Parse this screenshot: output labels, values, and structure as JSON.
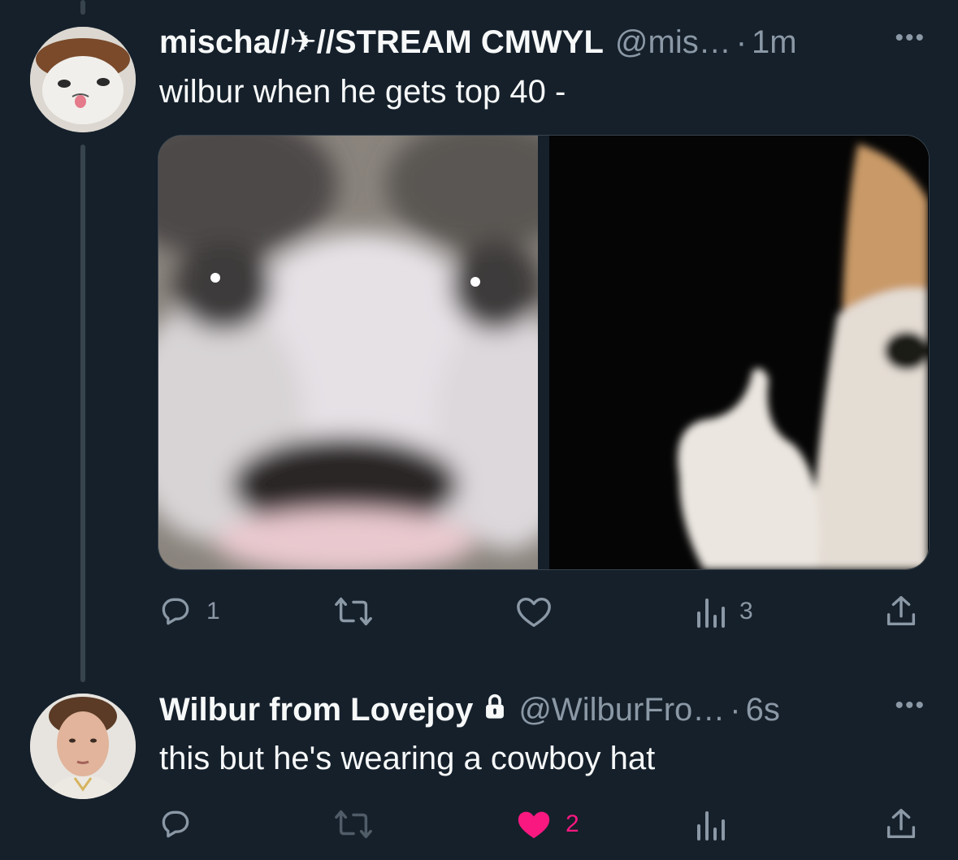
{
  "tweets": [
    {
      "display_name": "mischa//✈//STREAM CMWYL",
      "handle": "@mis…",
      "separator": "·",
      "time": "1m",
      "more": "•••",
      "text": "wilbur when he gets top 40 -",
      "actions": {
        "reply_count": "1",
        "retweet_count": "",
        "like_count": "",
        "views_count": "3"
      }
    },
    {
      "display_name": "Wilbur from Lovejoy",
      "handle": "@WilburFro…",
      "separator": "·",
      "time": "6s",
      "more": "•••",
      "text": "this but he's wearing a cowboy hat",
      "actions": {
        "reply_count": "",
        "retweet_count": "",
        "like_count": "2",
        "views_count": ""
      }
    }
  ],
  "colors": {
    "background": "#15202b",
    "muted": "#8b98a5",
    "like_active": "#f91880",
    "thread_line": "#38444d"
  },
  "icons": [
    "reply-icon",
    "retweet-icon",
    "like-icon",
    "views-icon",
    "share-icon",
    "lock-icon",
    "more-icon"
  ]
}
